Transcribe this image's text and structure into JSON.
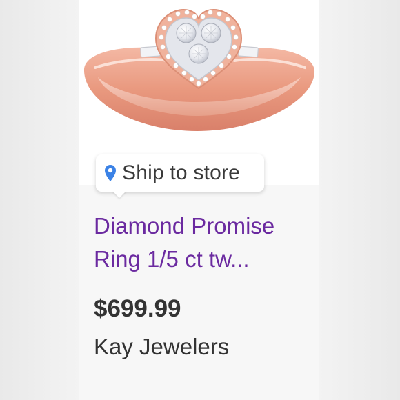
{
  "product": {
    "image_alt": "rose gold heart diamond ring",
    "badge": {
      "icon": "location-pin-icon",
      "label": "Ship to store"
    },
    "title": "Diamond Promise Ring 1/5 ct tw...",
    "price": "$699.99",
    "seller": "Kay Jewelers"
  },
  "colors": {
    "title": "#6b2aa0",
    "pin": "#3b82e6",
    "text": "#333333"
  }
}
